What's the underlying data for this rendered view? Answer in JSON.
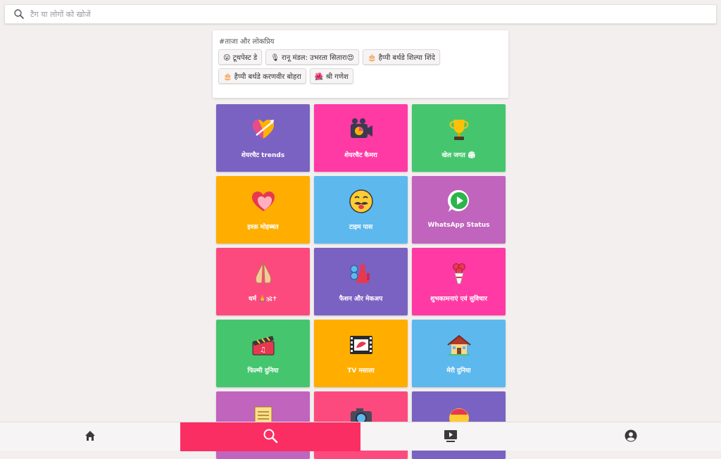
{
  "search": {
    "placeholder": "टैग या लोगों को खोजें"
  },
  "tags": {
    "title": "#ताजा और लोकप्रिय",
    "chips": [
      "😛 टूथपेस्ट डे",
      "🎙 रानू मंडल: उभरता सितारा😍",
      "🎂 हैप्पी बर्थडे शिल्पा शिंदे",
      "🎂 हैप्पी बर्थडे करणवीर बोहरा",
      "🌺 श्री गणेश"
    ]
  },
  "categories": [
    {
      "label": "शेयरचैट trends",
      "color": "#7a62c2",
      "icon": "heart-arrow-icon"
    },
    {
      "label": "शेयरचैट कैमरा",
      "color": "#ff3aa5",
      "icon": "video-camera-icon"
    },
    {
      "label": "खेल जगत 🏟",
      "color": "#45c66e",
      "icon": "trophy-icon"
    },
    {
      "label": "इश्क़ मोहब्बत",
      "color": "#ffae00",
      "icon": "heart-icon"
    },
    {
      "label": "टाइम पास",
      "color": "#5db8ee",
      "icon": "mustache-face-icon"
    },
    {
      "label": "WhatsApp Status",
      "color": "#c064be",
      "icon": "whatsapp-icon"
    },
    {
      "label": "धर्म 🙏🕉✝",
      "color": "#fd4a7e",
      "icon": "folded-hands-icon"
    },
    {
      "label": "फैशन और मेकअप",
      "color": "#7a62c2",
      "icon": "dress-icon"
    },
    {
      "label": "शुभकामनाएं एवं सुविचार",
      "color": "#ff3aa5",
      "icon": "bouquet-icon"
    },
    {
      "label": "फिल्मी दुनिया",
      "color": "#45c66e",
      "icon": "clapper-icon"
    },
    {
      "label": "TV मसाला",
      "color": "#ffae00",
      "icon": "film-strip-icon"
    },
    {
      "label": "मेरी दुनिया",
      "color": "#5db8ee",
      "icon": "house-icon"
    },
    {
      "label": "",
      "color": "#c064be",
      "icon": "scroll-icon"
    },
    {
      "label": "",
      "color": "#fd4a7e",
      "icon": "camera-icon"
    },
    {
      "label": "",
      "color": "#7a62c2",
      "icon": "face-cap-icon"
    }
  ],
  "nav": [
    {
      "name": "home",
      "icon": "home-icon",
      "active": false
    },
    {
      "name": "search",
      "icon": "search-icon",
      "active": true
    },
    {
      "name": "videos",
      "icon": "play-screen-icon",
      "active": false
    },
    {
      "name": "profile",
      "icon": "account-icon",
      "active": false
    }
  ]
}
